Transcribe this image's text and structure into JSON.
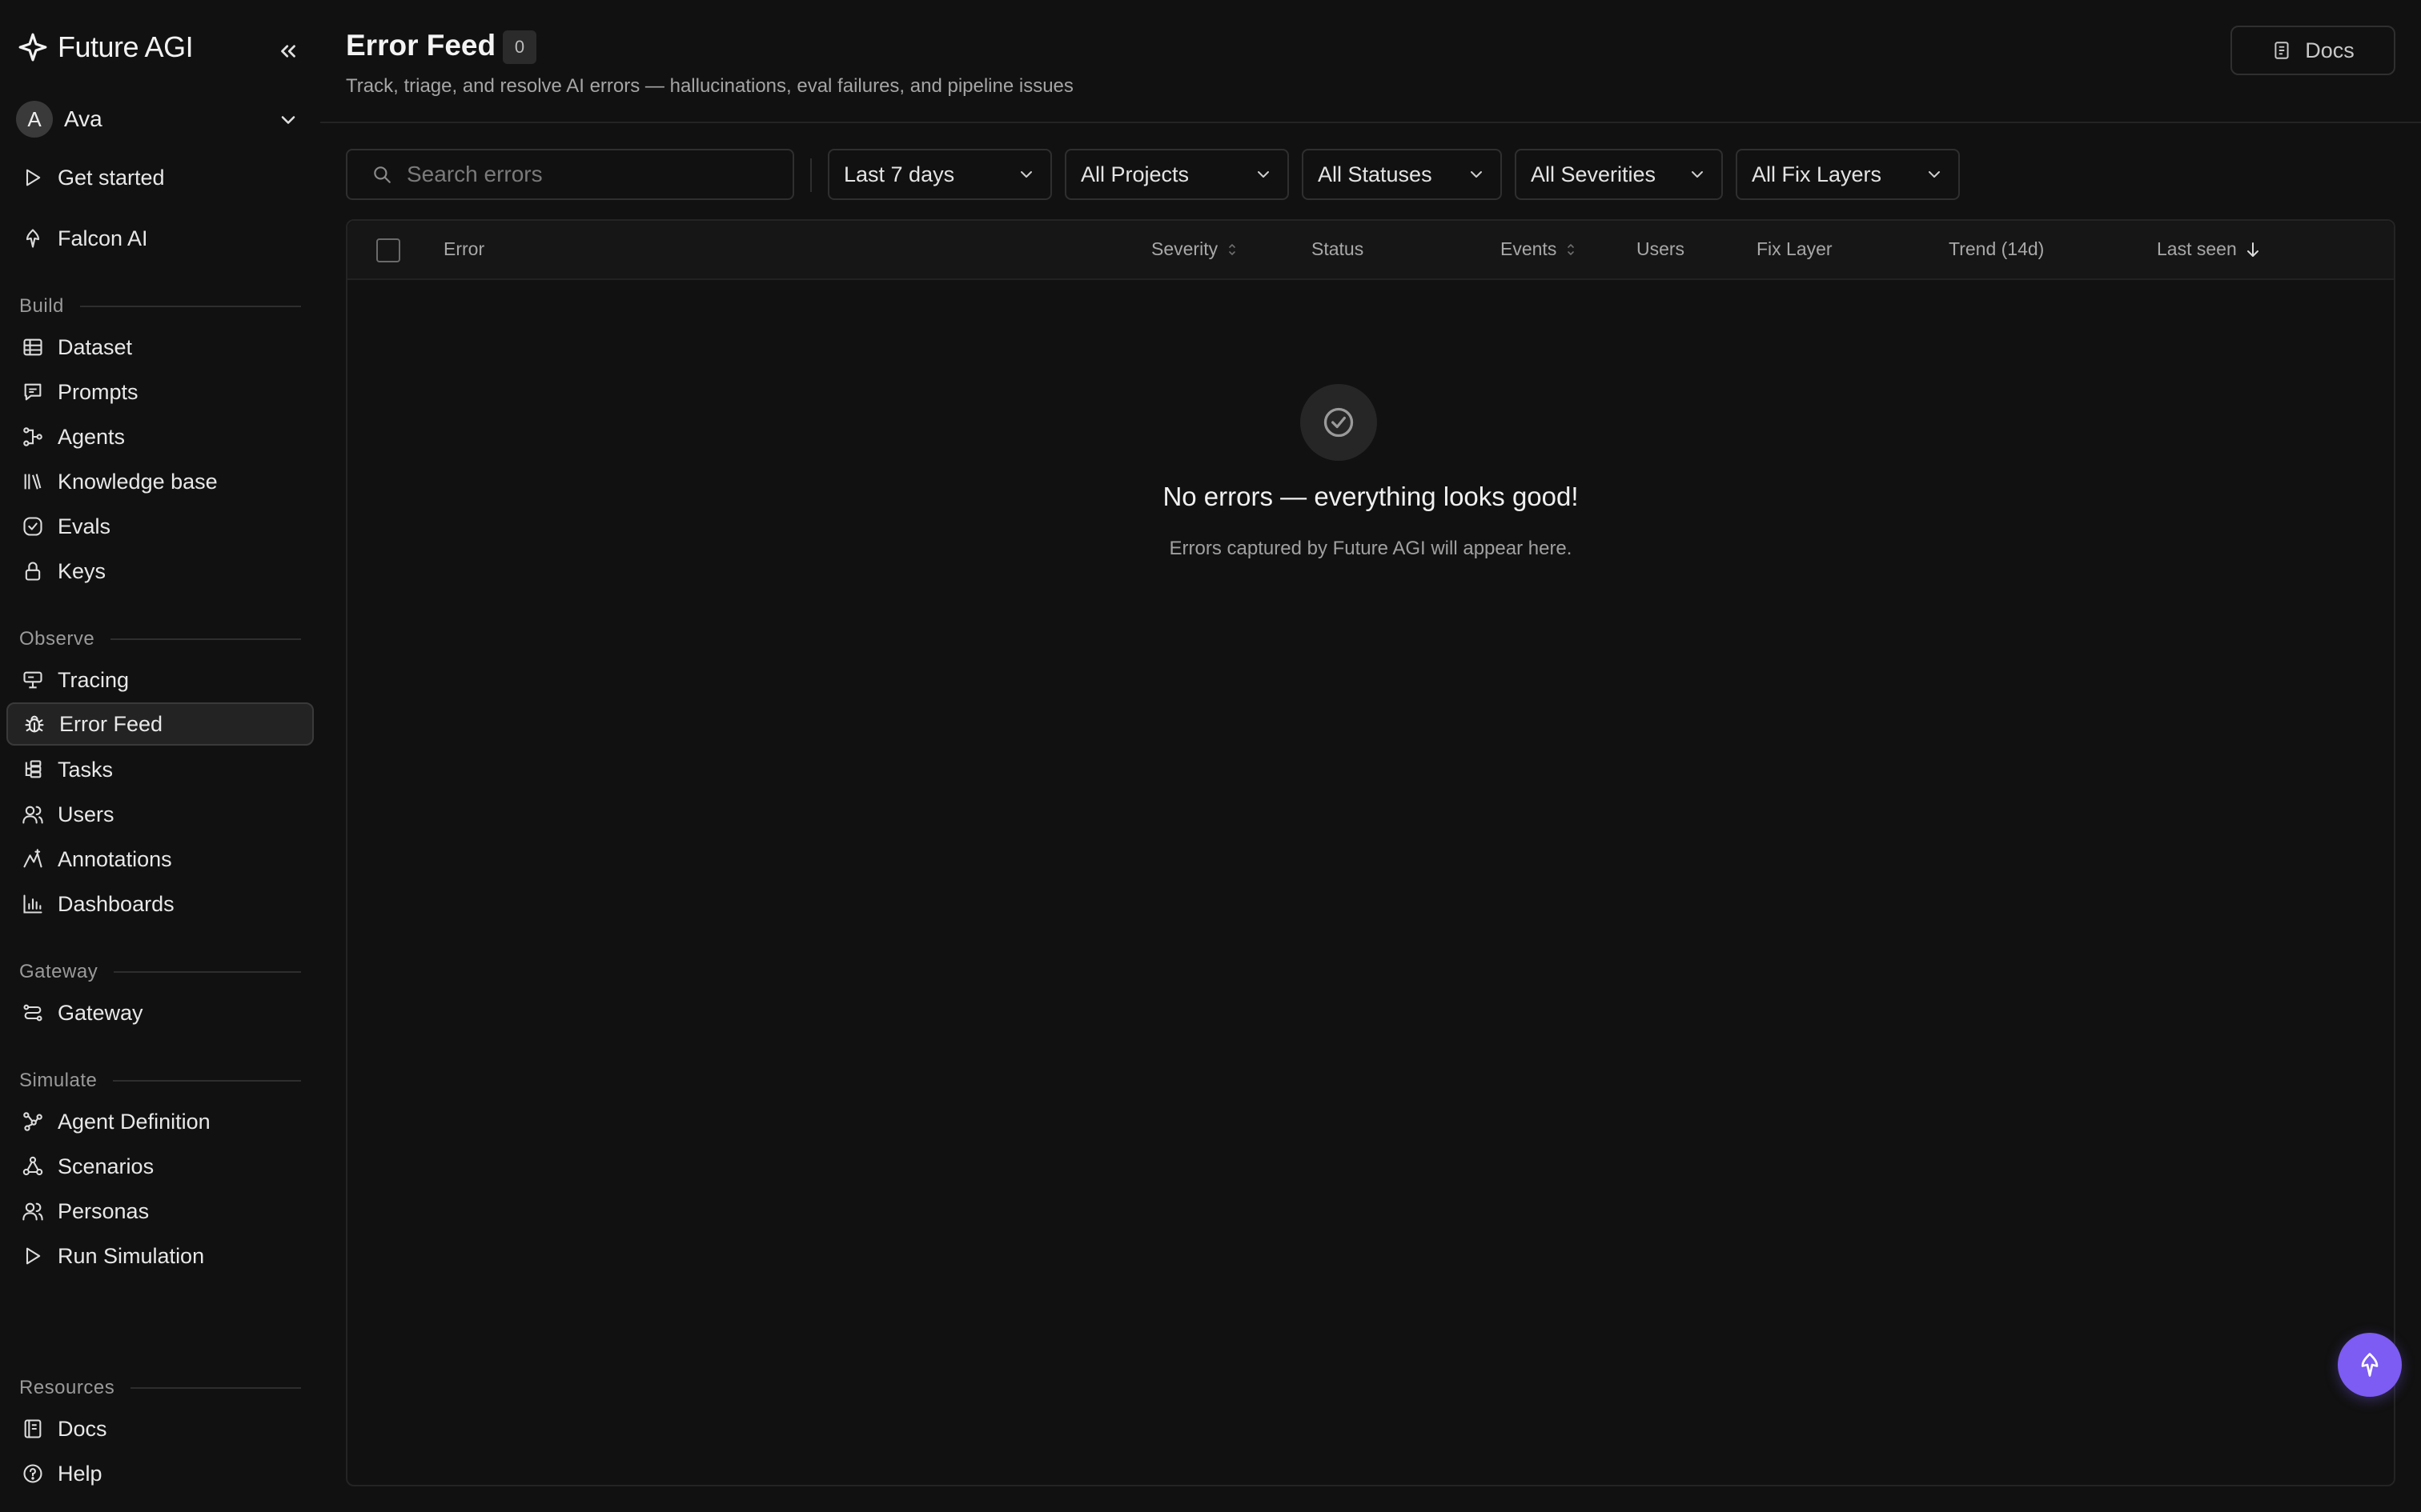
{
  "sidebar": {
    "brand": "Future AGI",
    "workspace": {
      "initial": "A",
      "name": "Ava"
    },
    "top_items": [
      {
        "label": "Get started",
        "icon": "play-icon"
      },
      {
        "label": "Falcon AI",
        "icon": "falcon-icon"
      }
    ],
    "sections": [
      {
        "title": "Build",
        "items": [
          {
            "label": "Dataset",
            "icon": "table-icon"
          },
          {
            "label": "Prompts",
            "icon": "prompt-icon"
          },
          {
            "label": "Agents",
            "icon": "agent-icon"
          },
          {
            "label": "Knowledge base",
            "icon": "library-icon"
          },
          {
            "label": "Evals",
            "icon": "check-circle-icon"
          },
          {
            "label": "Keys",
            "icon": "lock-icon"
          }
        ]
      },
      {
        "title": "Observe",
        "items": [
          {
            "label": "Tracing",
            "icon": "tracing-icon"
          },
          {
            "label": "Error Feed",
            "icon": "bug-icon",
            "active": true
          },
          {
            "label": "Tasks",
            "icon": "tasks-icon"
          },
          {
            "label": "Users",
            "icon": "users-icon"
          },
          {
            "label": "Annotations",
            "icon": "annotation-icon"
          },
          {
            "label": "Dashboards",
            "icon": "bar-chart-icon"
          }
        ]
      },
      {
        "title": "Gateway",
        "items": [
          {
            "label": "Gateway",
            "icon": "gateway-icon"
          }
        ]
      },
      {
        "title": "Simulate",
        "items": [
          {
            "label": "Agent Definition",
            "icon": "nodes-icon"
          },
          {
            "label": "Scenarios",
            "icon": "scenarios-icon"
          },
          {
            "label": "Personas",
            "icon": "users-icon"
          },
          {
            "label": "Run Simulation",
            "icon": "play-icon"
          }
        ]
      },
      {
        "title": "Resources",
        "items": [
          {
            "label": "Docs",
            "icon": "book-icon"
          },
          {
            "label": "Help",
            "icon": "help-icon"
          }
        ]
      }
    ]
  },
  "header": {
    "title": "Error Feed",
    "count": "0",
    "subtitle": "Track, triage, and resolve AI errors — hallucinations, eval failures, and pipeline issues",
    "docs_label": "Docs"
  },
  "filters": {
    "search_placeholder": "Search errors",
    "time_range": "Last 7 days",
    "projects": "All Projects",
    "statuses": "All Statuses",
    "severities": "All Severities",
    "fix_layers": "All Fix Layers"
  },
  "table": {
    "columns": {
      "error": "Error",
      "severity": "Severity",
      "status": "Status",
      "events": "Events",
      "users": "Users",
      "fix_layer": "Fix Layer",
      "trend": "Trend (14d)",
      "last_seen": "Last seen"
    },
    "rows": []
  },
  "empty_state": {
    "title": "No errors — everything looks good!",
    "subtitle": "Errors captured by Future AGI will appear here."
  },
  "colors": {
    "background": "#111111",
    "accent": "#7c5cf2"
  }
}
